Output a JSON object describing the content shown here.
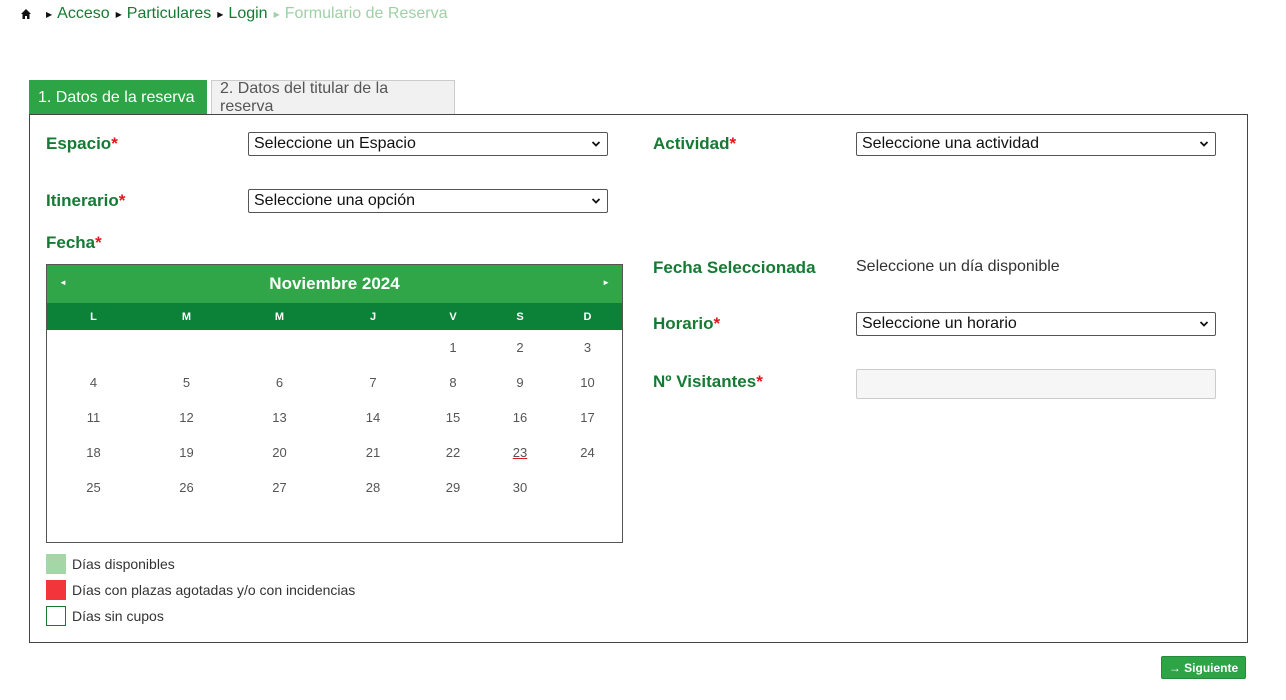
{
  "breadcrumb": {
    "items": [
      "Acceso",
      "Particulares",
      "Login"
    ],
    "current": "Formulario de Reserva"
  },
  "tabs": [
    {
      "label": "1. Datos de la reserva",
      "active": true
    },
    {
      "label": "2. Datos del titular de la reserva",
      "active": false
    }
  ],
  "form": {
    "espacio": {
      "label": "Espacio",
      "value": "Seleccione un Espacio"
    },
    "actividad": {
      "label": "Actividad",
      "value": "Seleccione una actividad"
    },
    "itinerario": {
      "label": "Itinerario",
      "value": "Seleccione una opción"
    },
    "fecha": {
      "label": "Fecha"
    },
    "fecha_seleccionada": {
      "label": "Fecha Seleccionada",
      "value": "Seleccione un día disponible"
    },
    "horario": {
      "label": "Horario",
      "value": "Seleccione un horario"
    },
    "visitantes": {
      "label": "Nº Visitantes",
      "value": ""
    },
    "required_mark": "*"
  },
  "calendar": {
    "month_label": "Noviembre 2024",
    "prev_glyph": "◄",
    "next_glyph": "►",
    "weekdays": [
      "L",
      "M",
      "M",
      "J",
      "V",
      "S",
      "D"
    ],
    "weeks": [
      [
        "",
        "",
        "",
        "",
        "1",
        "2",
        "3"
      ],
      [
        "4",
        "5",
        "6",
        "7",
        "8",
        "9",
        "10"
      ],
      [
        "11",
        "12",
        "13",
        "14",
        "15",
        "16",
        "17"
      ],
      [
        "18",
        "19",
        "20",
        "21",
        "22",
        "23",
        "24"
      ],
      [
        "25",
        "26",
        "27",
        "28",
        "29",
        "30",
        ""
      ]
    ],
    "today": "23"
  },
  "legend": [
    {
      "label": "Días disponibles",
      "color": "#a5d6a7"
    },
    {
      "label": "Días con plazas agotadas y/o con incidencias",
      "color": "#f2353a"
    },
    {
      "label": "Días sin cupos",
      "color": "#ffffff"
    }
  ],
  "next_button": {
    "label": "→ Siguiente"
  },
  "colors": {
    "brand_green": "#2da446",
    "dark_green": "#0c8138",
    "label_green": "#167a34",
    "required_red": "#e0161b"
  }
}
